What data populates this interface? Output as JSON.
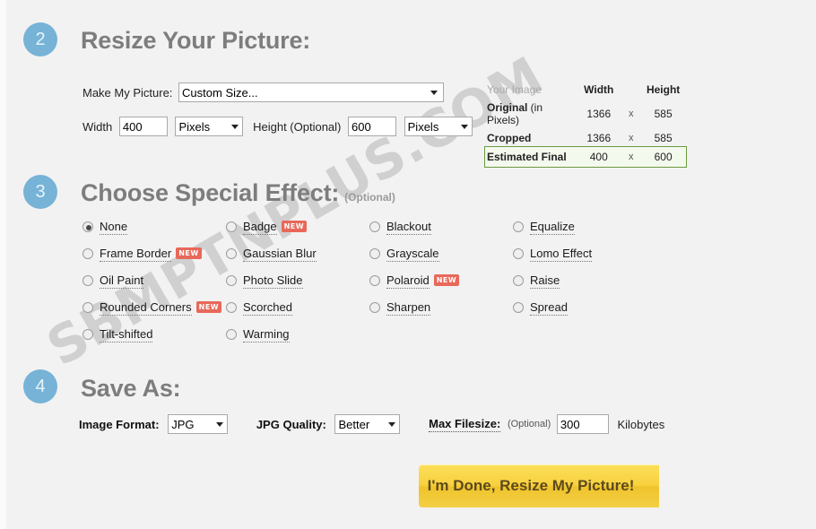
{
  "watermark": {
    "text": "SBMPTNPLUS.COM"
  },
  "step2": {
    "number": "2",
    "title": "Resize Your Picture:",
    "make_my_picture_label": "Make My Picture:",
    "size_preset_value": "Custom Size...",
    "width_label": "Width",
    "width_value": "400",
    "width_unit": "Pixels",
    "height_label": "Height (Optional)",
    "height_value": "600",
    "height_unit": "Pixels"
  },
  "info_table": {
    "headers": [
      "Your Image",
      "Width",
      "Height"
    ],
    "separator": "x",
    "rows": [
      {
        "label": "Original",
        "label_thin": " (in Pixels)",
        "width": "1366",
        "height": "585",
        "highlight": false
      },
      {
        "label": "Cropped",
        "label_thin": "",
        "width": "1366",
        "height": "585",
        "highlight": false
      },
      {
        "label": "Estimated Final",
        "label_thin": "",
        "width": "400",
        "height": "600",
        "highlight": true
      }
    ],
    "highlight_border_color": "#6a9a3e",
    "highlight_bg_color": "#f4f9ee"
  },
  "step3": {
    "number": "3",
    "title": "Choose Special Effect:",
    "optional": "(Optional)",
    "columns": [
      [
        {
          "label": "None",
          "checked": true,
          "badge": ""
        },
        {
          "label": "Frame Border",
          "checked": false,
          "badge": "NEW"
        },
        {
          "label": "Oil Paint",
          "checked": false,
          "badge": ""
        },
        {
          "label": "Rounded Corners",
          "checked": false,
          "badge": "NEW"
        },
        {
          "label": "Tilt-shifted",
          "checked": false,
          "badge": ""
        }
      ],
      [
        {
          "label": "Badge",
          "checked": false,
          "badge": "NEW"
        },
        {
          "label": "Gaussian Blur",
          "checked": false,
          "badge": ""
        },
        {
          "label": "Photo Slide",
          "checked": false,
          "badge": ""
        },
        {
          "label": "Scorched",
          "checked": false,
          "badge": ""
        },
        {
          "label": "Warming",
          "checked": false,
          "badge": ""
        }
      ],
      [
        {
          "label": "Blackout",
          "checked": false,
          "badge": ""
        },
        {
          "label": "Grayscale",
          "checked": false,
          "badge": ""
        },
        {
          "label": "Polaroid",
          "checked": false,
          "badge": "NEW"
        },
        {
          "label": "Sharpen",
          "checked": false,
          "badge": ""
        }
      ],
      [
        {
          "label": "Equalize",
          "checked": false,
          "badge": ""
        },
        {
          "label": "Lomo Effect",
          "checked": false,
          "badge": ""
        },
        {
          "label": "Raise",
          "checked": false,
          "badge": ""
        },
        {
          "label": "Spread",
          "checked": false,
          "badge": ""
        }
      ]
    ]
  },
  "step4": {
    "number": "4",
    "title": "Save As:",
    "image_format_label": "Image Format:",
    "image_format_value": "JPG",
    "jpg_quality_label": "JPG Quality:",
    "jpg_quality_value": "Better",
    "max_filesize_label": "Max Filesize:",
    "max_filesize_optional": "(Optional)",
    "max_filesize_value": "300",
    "max_filesize_unit": "Kilobytes"
  },
  "submit": {
    "label": "I'm Done, Resize My Picture!"
  },
  "colors": {
    "page_bg": "#f2f2f2",
    "step_circle": "#76b3d6",
    "heading": "#7d7d7d",
    "badge_new": "#e8685a",
    "button_yellow": "#f8d13f"
  }
}
